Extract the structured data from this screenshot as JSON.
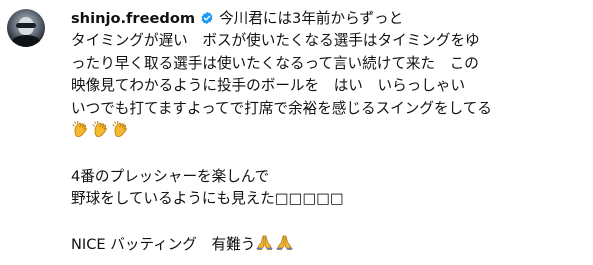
{
  "comment": {
    "username": "shinjo.freedom",
    "verified_icon": "verified-badge-icon",
    "accent_color": "#1d9bf0",
    "line1": "今川君には3年前からずっと",
    "line2": "タイミングが遅い　ボスが使いたくなる選手はタイミングをゆ",
    "line3": "ったり早く取る選手は使いたくなるって言い続けて来た　この",
    "line4": "映像見てわかるように投手のボールを　はい　いらっしゃい",
    "line5": "いつでも打てますよってで打席で余裕を感じるスイングをしてる",
    "clap_emojis": [
      "clapping-hands-emoji",
      "clapping-hands-emoji",
      "clapping-hands-emoji"
    ],
    "line6": "4番のプレッシャーを楽しんで",
    "line7": "野球をしているようにも見えた□□□□□",
    "line8": "NICE バッティング　有難う",
    "pray_emojis": [
      "folded-hands-emoji",
      "folded-hands-emoji"
    ]
  }
}
